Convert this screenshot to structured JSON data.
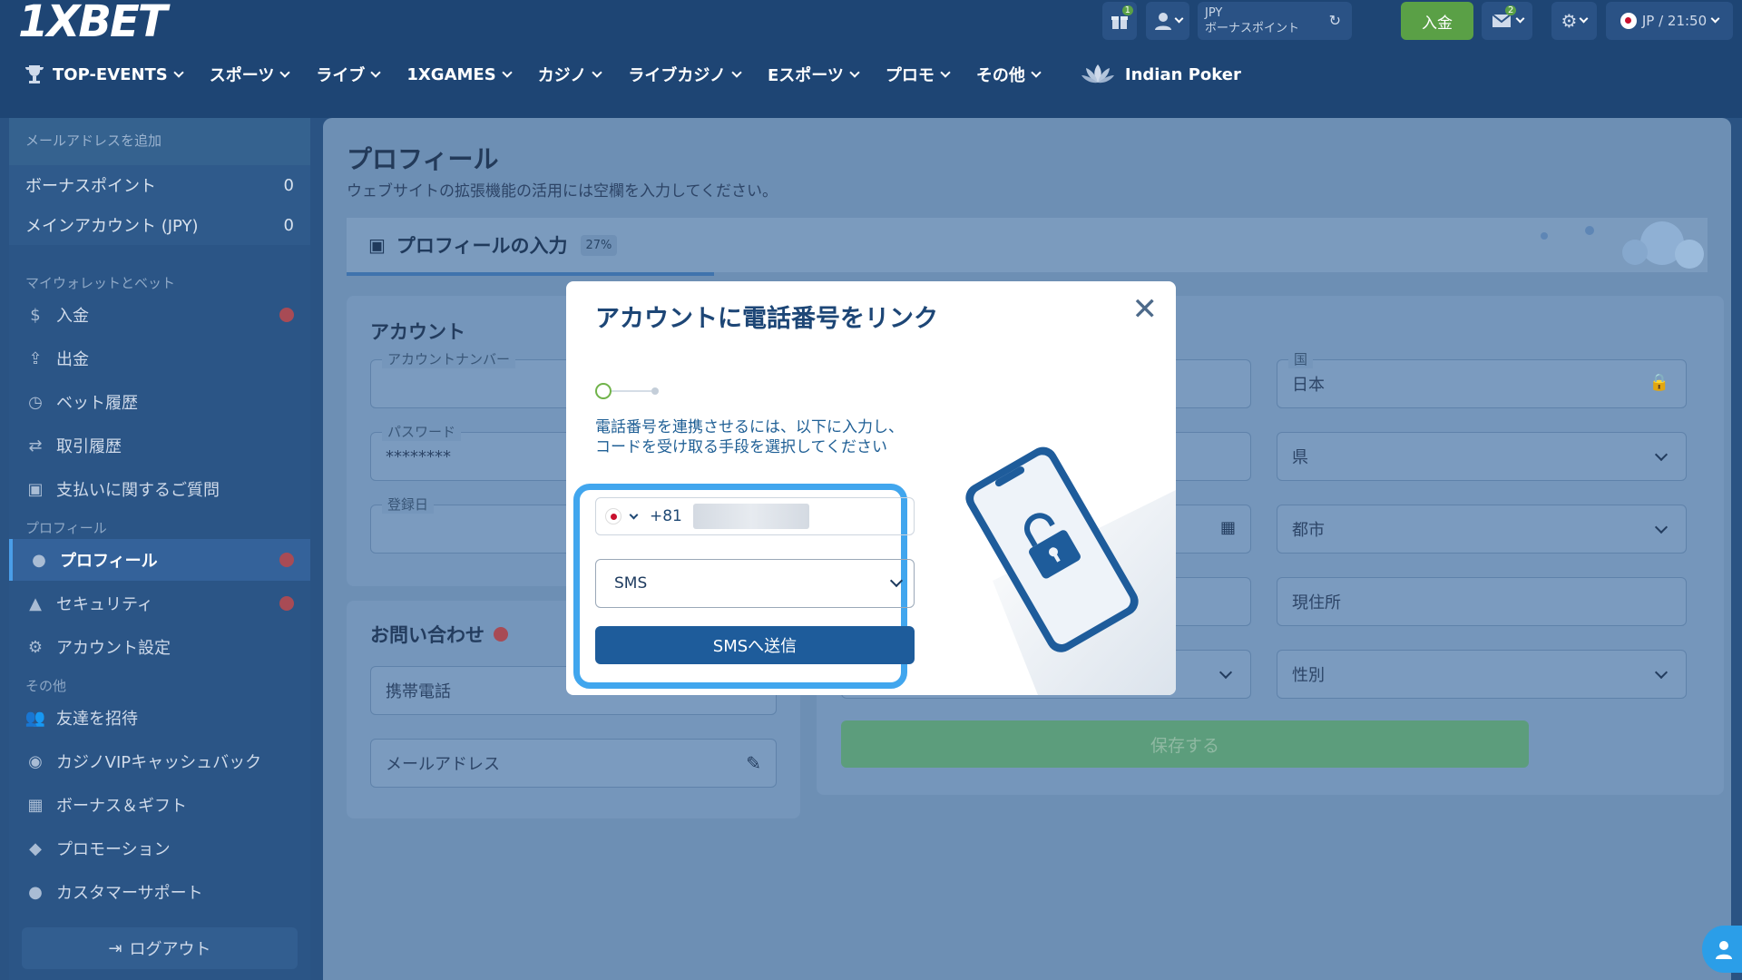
{
  "header": {
    "logo": "1XBET",
    "gift_badge": "1",
    "currency": "JPY",
    "bonus_points_label": "ボーナスポイント",
    "deposit_label": "入金",
    "mail_badge": "2",
    "locale_time": "JP / 21:50"
  },
  "nav": {
    "items": [
      {
        "label": "TOP-EVENTS"
      },
      {
        "label": "スポーツ"
      },
      {
        "label": "ライブ"
      },
      {
        "label": "1XGAMES"
      },
      {
        "label": "カジノ"
      },
      {
        "label": "ライブカジノ"
      },
      {
        "label": "Eスポーツ"
      },
      {
        "label": "プロモ"
      },
      {
        "label": "その他"
      }
    ],
    "special": "Indian Poker"
  },
  "sidebar": {
    "add_email": "メールアドレスを追加",
    "balances": [
      {
        "label": "ボーナスポイント",
        "value": "0"
      },
      {
        "label": "メインアカウント (JPY)",
        "value": "0"
      }
    ],
    "section_wallet": "マイウォレットとベット",
    "wallet_items": [
      {
        "label": "入金"
      },
      {
        "label": "出金"
      },
      {
        "label": "ベット履歴"
      },
      {
        "label": "取引履歴"
      },
      {
        "label": "支払いに関するご質問"
      }
    ],
    "section_profile": "プロフィール",
    "profile_items": [
      {
        "label": "プロフィール"
      },
      {
        "label": "セキュリティ"
      },
      {
        "label": "アカウント設定"
      }
    ],
    "section_other": "その他",
    "other_items": [
      {
        "label": "友達を招待"
      },
      {
        "label": "カジノVIPキャッシュバック"
      },
      {
        "label": "ボーナス＆ギフト"
      },
      {
        "label": "プロモーション"
      },
      {
        "label": "カスタマーサポート"
      }
    ],
    "logout": "ログアウト"
  },
  "main": {
    "title": "プロフィール",
    "subtitle": "ウェブサイトの拡張機能の活用には空欄を入力してください。",
    "progress_label": "プロフィールの入力",
    "progress_percent": "27%",
    "progress_value": 0.27,
    "account": {
      "title": "アカウント",
      "account_number_label": "アカウントナンバー",
      "password_label": "パスワード",
      "password_value": "********",
      "registration_label": "登録日"
    },
    "contact": {
      "title": "お問い合わせ",
      "mobile_label": "携帯電話",
      "email_label": "メールアドレス"
    },
    "personal": {
      "country_label": "国",
      "country_value": "日本",
      "region_placeholder": "県",
      "city_placeholder": "都市",
      "address_placeholder": "現住所",
      "gender_placeholder": "性別",
      "save_label": "保存する"
    }
  },
  "modal": {
    "title": "アカウントに電話番号をリンク",
    "description": "電話番号を連携させるには、以下に入力し、コードを受け取る手段を選択してください",
    "country_code": "+81",
    "method": "SMS",
    "send_label": "SMSへ送信"
  }
}
